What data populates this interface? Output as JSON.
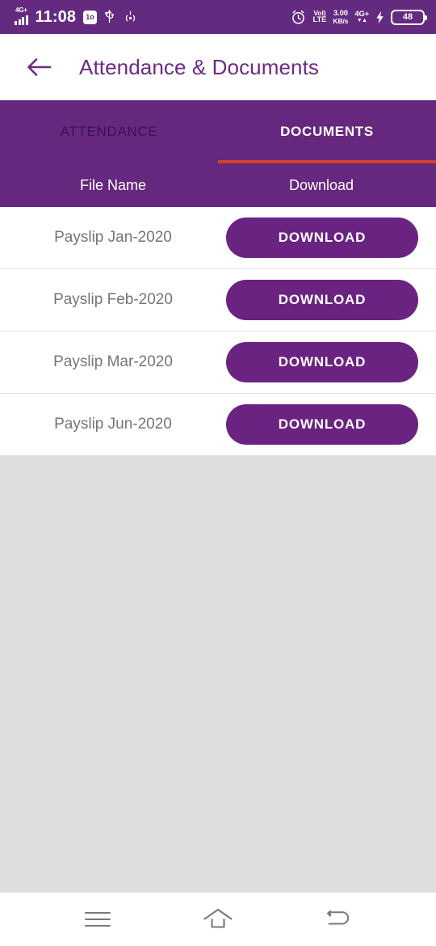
{
  "status_bar": {
    "network_badge": "4G+",
    "time": "11:08",
    "data_saver_label": "1o",
    "usb_icon": "usb-icon",
    "cast_icon": "cast-icon",
    "alarm_icon": "alarm-icon",
    "volte_line1": "VoI)",
    "volte_line2": "LTE",
    "speed_value": "3.00",
    "speed_unit": "KB/s",
    "network_type": "4G+",
    "network_arrows": "▼▲",
    "charging_icon": "bolt-icon",
    "battery_level": "48",
    "background_color": "#632a80"
  },
  "app_bar": {
    "back_icon": "arrow-left-icon",
    "title": "Attendance & Documents",
    "title_color": "#6a2a85"
  },
  "tabs": {
    "items": [
      {
        "label": "ATTENDANCE",
        "active": false
      },
      {
        "label": "DOCUMENTS",
        "active": true
      }
    ],
    "indicator_color": "#d2412c",
    "background_color": "#66277f"
  },
  "table": {
    "columns": [
      "File Name",
      "Download"
    ],
    "rows": [
      {
        "file_name": "Payslip Jan-2020",
        "action_label": "DOWNLOAD"
      },
      {
        "file_name": "Payslip Feb-2020",
        "action_label": "DOWNLOAD"
      },
      {
        "file_name": "Payslip Mar-2020",
        "action_label": "DOWNLOAD"
      },
      {
        "file_name": "Payslip Jun-2020",
        "action_label": "DOWNLOAD"
      }
    ],
    "button_color": "#6a2380",
    "row_text_color": "#757575"
  },
  "empty_area_color": "#dedede",
  "nav_bar": {
    "items": [
      {
        "icon": "menu-icon"
      },
      {
        "icon": "home-icon"
      },
      {
        "icon": "back-icon"
      }
    ],
    "icon_color": "#7a7a7a"
  }
}
